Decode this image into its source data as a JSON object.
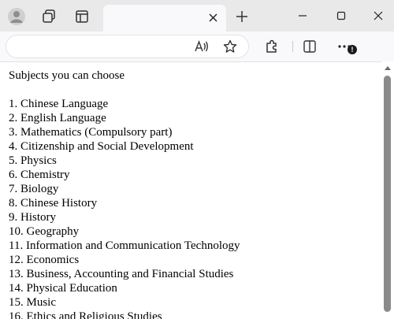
{
  "browser": {
    "tab": {
      "title": "",
      "close_icon": "close-icon"
    },
    "address_bar": {
      "value": "",
      "placeholder": ""
    },
    "toolbar_icons": [
      "read-aloud-icon",
      "favorite-star-icon",
      "extensions-icon",
      "split-screen-icon",
      "more-menu-icon"
    ],
    "more_menu_badge": "!",
    "window_controls": [
      "minimize-icon",
      "maximize-icon",
      "close-icon"
    ]
  },
  "page": {
    "heading": "Subjects you can choose",
    "subjects": [
      "1. Chinese Language",
      "2. English Language",
      "3. Mathematics (Compulsory part)",
      "4. Citizenship and Social Development",
      "5. Physics",
      "6. Chemistry",
      "7. Biology",
      "8. Chinese History",
      "9. History",
      "10. Geography",
      "11. Information and Communication Technology",
      "12. Economics",
      "13. Business, Accounting and Financial Studies",
      "14. Physical Education",
      "15. Music",
      "16. Ethics and Religious Studies"
    ]
  },
  "colors": {
    "chrome_bg": "#e9e9e9",
    "toolbar_bg": "#f9f9fb",
    "page_bg": "#ffffff",
    "text": "#000000",
    "scroll_thumb": "#8a8a8a"
  }
}
